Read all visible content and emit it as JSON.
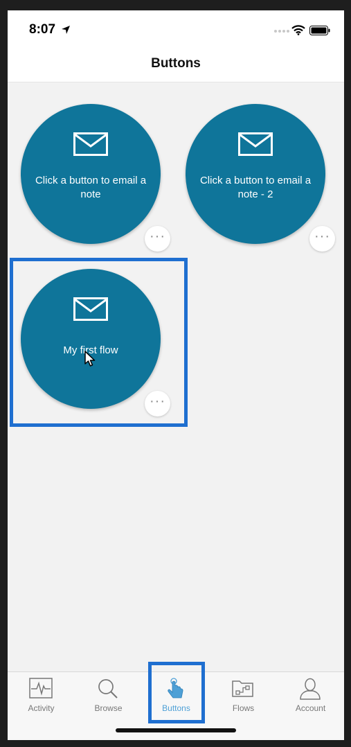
{
  "status": {
    "time": "8:07",
    "icons": [
      "location-arrow-icon",
      "signal-icon",
      "wifi-icon",
      "battery-icon"
    ]
  },
  "header": {
    "title": "Buttons"
  },
  "buttons": [
    {
      "label": "Click a button to email a note",
      "icon": "mail-icon",
      "more_label": "···"
    },
    {
      "label": "Click a button to email a note - 2",
      "icon": "mail-icon",
      "more_label": "···"
    },
    {
      "label": "My first flow",
      "icon": "mail-icon",
      "more_label": "···"
    }
  ],
  "tabs": [
    {
      "label": "Activity",
      "icon": "activity-icon"
    },
    {
      "label": "Browse",
      "icon": "search-icon"
    },
    {
      "label": "Buttons",
      "icon": "touch-icon",
      "selected": true
    },
    {
      "label": "Flows",
      "icon": "flows-folder-icon"
    },
    {
      "label": "Account",
      "icon": "account-icon"
    }
  ],
  "colors": {
    "accent": "#0f759a",
    "highlight": "#1f6fd0",
    "tab_selected": "#4ea0d6",
    "tab_inactive": "#777777"
  }
}
